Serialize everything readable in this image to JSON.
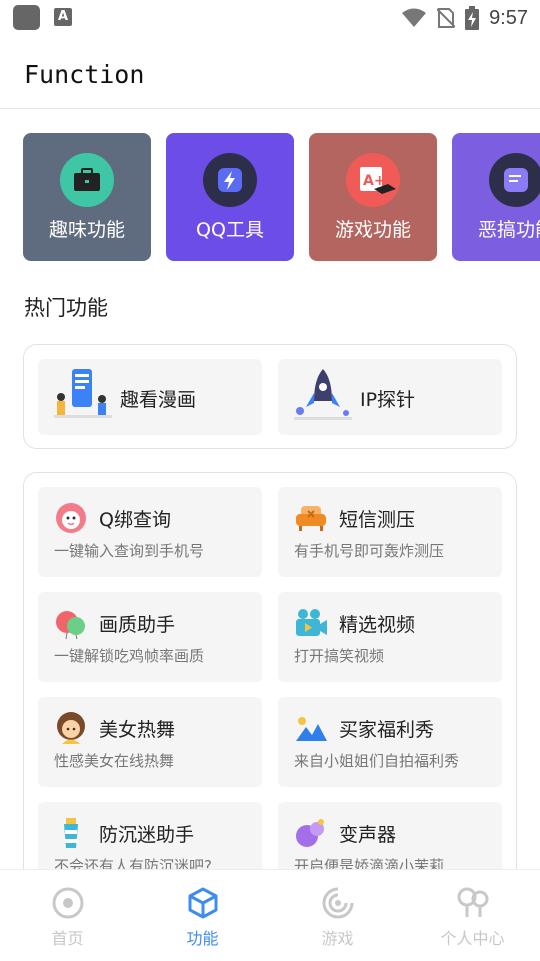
{
  "status_bar": {
    "app_icon": "app-notification-icon",
    "a_badge": "A",
    "time": "9:57"
  },
  "header": {
    "title": "Function"
  },
  "categories": [
    {
      "label": "趣味功能",
      "icon": "briefcase-icon",
      "color": "#5f6b7e"
    },
    {
      "label": "QQ工具",
      "icon": "lightning-icon",
      "color": "#6d4de8"
    },
    {
      "label": "游戏功能",
      "icon": "grade-cap-icon",
      "color": "#b5655f"
    },
    {
      "label": "恶搞功能",
      "icon": "note-icon",
      "color": "#7c5fe0"
    }
  ],
  "hot_section": {
    "title": "热门功能",
    "items": [
      {
        "label": "趣看漫画",
        "icon": "phone-people-illustration"
      },
      {
        "label": "IP探针",
        "icon": "rocket-illustration"
      }
    ]
  },
  "functions": [
    {
      "title": "Q绑查询",
      "desc": "一键输入查询到手机号",
      "icon": "pink-monster-icon"
    },
    {
      "title": "短信测压",
      "desc": "有手机号即可轰炸测压",
      "icon": "sofa-icon"
    },
    {
      "title": "画质助手",
      "desc": "一键解锁吃鸡帧率画质",
      "icon": "balloon-icon"
    },
    {
      "title": "精选视频",
      "desc": "打开搞笑视频",
      "icon": "video-camera-icon"
    },
    {
      "title": "美女热舞",
      "desc": "性感美女在线热舞",
      "icon": "girl-avatar-icon"
    },
    {
      "title": "买家福利秀",
      "desc": "来自小姐姐们自拍福利秀",
      "icon": "mountain-photo-icon"
    },
    {
      "title": "防沉迷助手",
      "desc": "不会还有人有防沉迷吧?",
      "icon": "lighthouse-icon"
    },
    {
      "title": "变声器",
      "desc": "开启便是娇滴滴小茉莉",
      "icon": "purple-voice-icon"
    }
  ],
  "bottom_nav": {
    "active_color": "#3d8cf0",
    "items": [
      {
        "label": "首页",
        "icon": "home-circle-icon",
        "active": false
      },
      {
        "label": "功能",
        "icon": "cube-icon",
        "active": true
      },
      {
        "label": "游戏",
        "icon": "game-swirl-icon",
        "active": false
      },
      {
        "label": "个人中心",
        "icon": "user-center-icon",
        "active": false
      }
    ]
  }
}
